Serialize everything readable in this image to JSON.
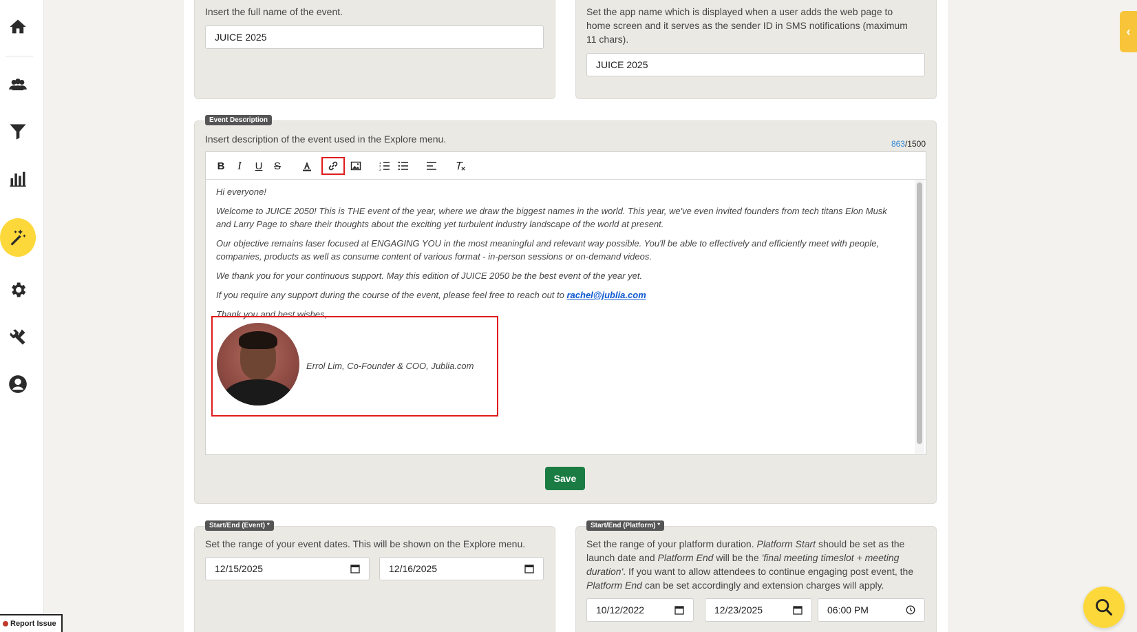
{
  "sidebar": {
    "items": [
      {
        "icon": "home-icon"
      },
      {
        "icon": "users-icon"
      },
      {
        "icon": "filter-icon"
      },
      {
        "icon": "chart-icon"
      },
      {
        "icon": "magic-wand-icon",
        "active": true
      },
      {
        "icon": "gear-icon"
      },
      {
        "icon": "tools-icon"
      },
      {
        "icon": "user-icon"
      }
    ],
    "active_color": "#fdd83a"
  },
  "event_name": {
    "help": "Insert the full name of the event.",
    "value": "JUICE 2025"
  },
  "app_name": {
    "help": "Set the app name which is displayed when a user adds the web page to home screen and it serves as the sender ID in SMS notifications (maximum 11 chars).",
    "value": "JUICE 2025"
  },
  "event_description": {
    "label": "Event Description",
    "help": "Insert description of the event used in the Explore menu.",
    "char_count": "863",
    "char_limit": "/1500",
    "toolbar": {
      "bold": "B",
      "italic": "I",
      "underline": "U",
      "strike": "S"
    },
    "content": {
      "p1": "Hi everyone!",
      "p2": "Welcome to JUICE 2050! This is THE event of the year, where we draw the biggest names in the world. This year, we've even invited founders from tech titans Elon Musk and Larry Page to share their thoughts about the exciting yet turbulent industry landscape of the world at present.",
      "p3": "Our objective remains laser focused at ENGAGING YOU in the most meaningful and relevant way possible. You'll be able to effectively and efficiently meet with people, companies, products as well as consume content of various format - in-person sessions or on-demand videos.",
      "p4": "We thank you for your continuous support. May this edition of JUICE 2050 be the best event of the year yet.",
      "p5_prefix": "If you require any support during the course of the event, please feel free to reach out to ",
      "p5_link": "rachel@jublia.com",
      "p6": "Thank you and best wishes,",
      "signature": "Errol Lim, Co-Founder & COO, Jublia.com"
    },
    "save_label": "Save",
    "save_color": "#1b7c43"
  },
  "event_dates": {
    "label": "Start/End (Event) *",
    "help": "Set the range of your event dates. This will be shown on the Explore menu.",
    "start": "12/15/2025",
    "end": "12/16/2025"
  },
  "platform_dates": {
    "label": "Start/End (Platform) *",
    "help_parts": [
      "Set the range of your platform duration. ",
      "Platform Start",
      " should be set as the launch date and ",
      "Platform End",
      " will be the ",
      "'final meeting timeslot + meeting duration'",
      ". If you want to allow attendees to continue engaging post event, the ",
      "Platform End",
      " can be set accordingly and extension charges will apply."
    ],
    "start": "10/12/2022",
    "end": "12/23/2025",
    "time": "06:00 PM"
  },
  "report_issue": "Report Issue"
}
